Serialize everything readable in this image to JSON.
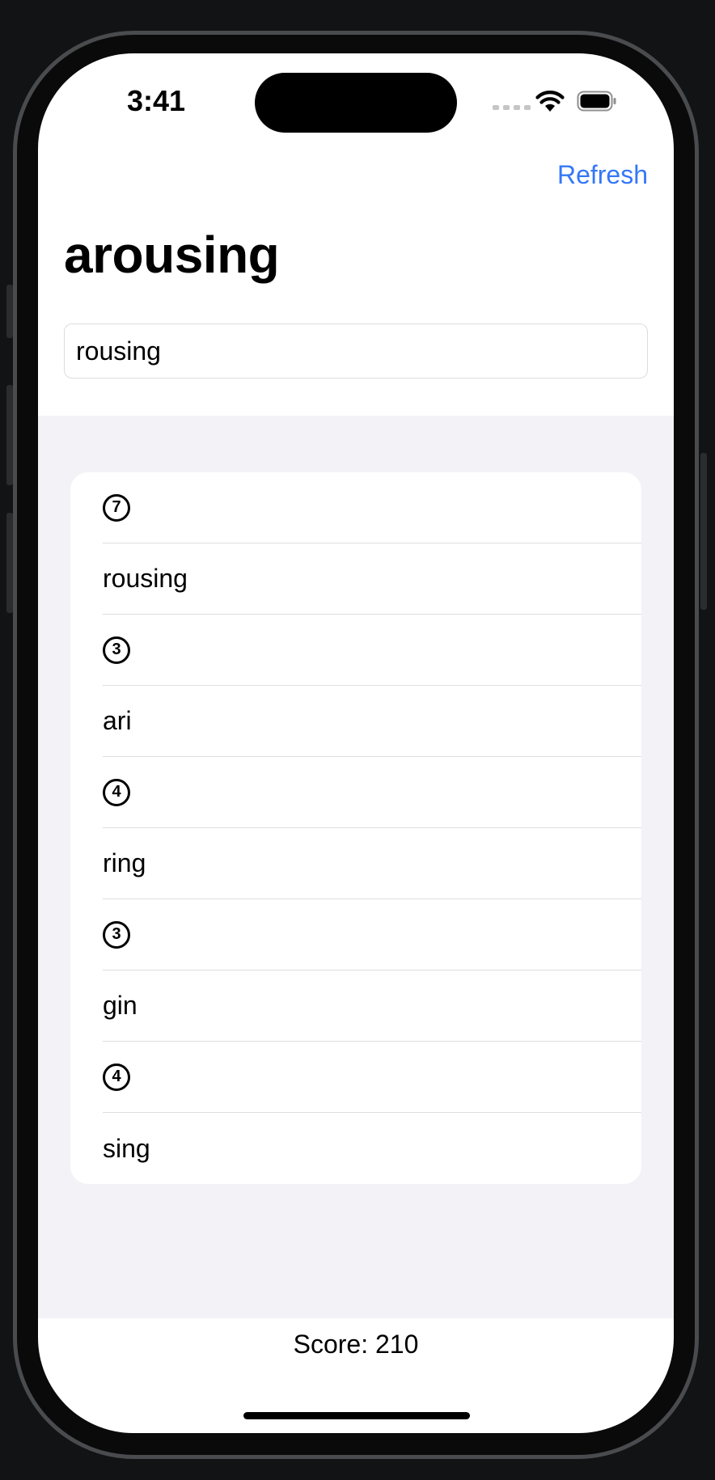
{
  "status_bar": {
    "time": "3:41"
  },
  "nav": {
    "refresh_label": "Refresh"
  },
  "root_word": "arousing",
  "input": {
    "value": "rousing"
  },
  "list": {
    "rows": [
      {
        "kind": "badge",
        "text": "7"
      },
      {
        "kind": "word",
        "text": "rousing"
      },
      {
        "kind": "badge",
        "text": "3"
      },
      {
        "kind": "word",
        "text": "ari"
      },
      {
        "kind": "badge",
        "text": "4"
      },
      {
        "kind": "word",
        "text": "ring"
      },
      {
        "kind": "badge",
        "text": "3"
      },
      {
        "kind": "word",
        "text": "gin"
      },
      {
        "kind": "badge",
        "text": "4"
      },
      {
        "kind": "word",
        "text": "sing"
      }
    ]
  },
  "footer": {
    "score": "Score: 210"
  },
  "colors": {
    "accent": "#3478f6",
    "grouped_background": "#f2f2f7"
  }
}
